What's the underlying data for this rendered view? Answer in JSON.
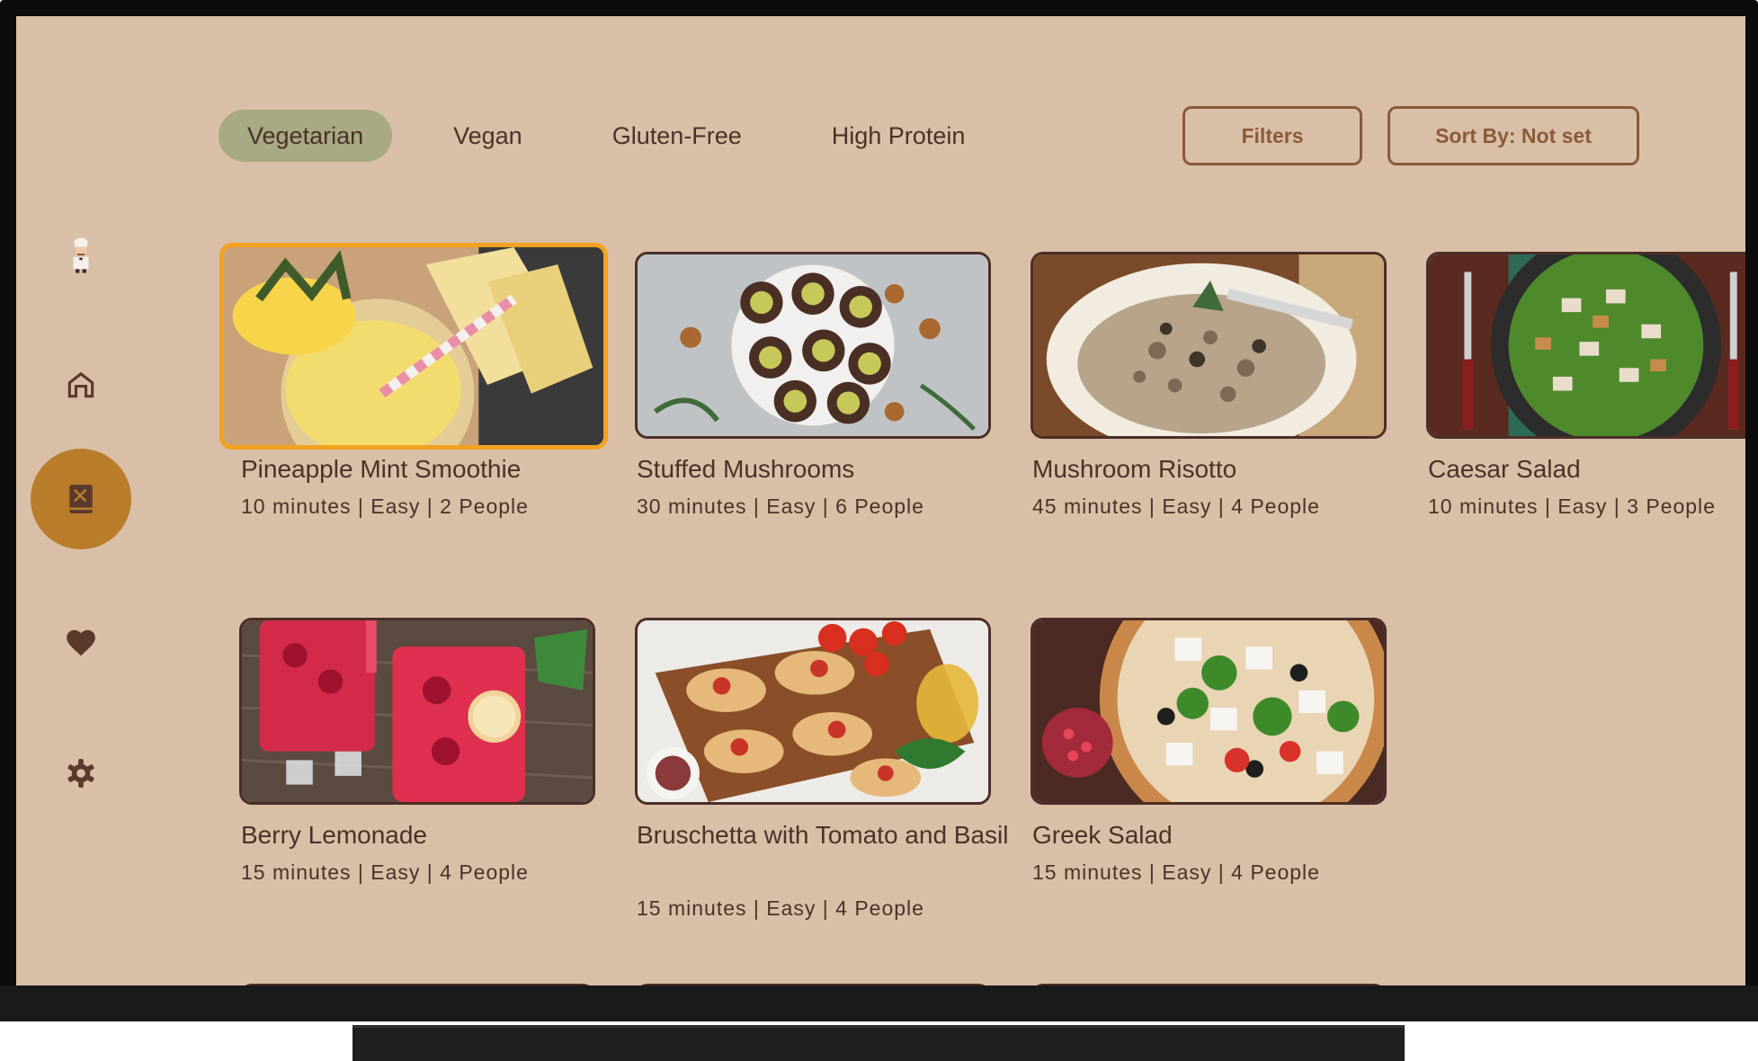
{
  "filters": {
    "chips": [
      {
        "label": "Vegetarian",
        "active": true
      },
      {
        "label": "Vegan",
        "active": false
      },
      {
        "label": "Gluten-Free",
        "active": false
      },
      {
        "label": "High Protein",
        "active": false
      }
    ],
    "filters_button": "Filters",
    "sort_button": "Sort By: Not set"
  },
  "nav": {
    "items": [
      {
        "name": "profile-avatar",
        "icon": "chef-avatar"
      },
      {
        "name": "home",
        "icon": "home-icon"
      },
      {
        "name": "recipes",
        "icon": "recipe-book-icon",
        "active": true
      },
      {
        "name": "favorites",
        "icon": "heart-icon"
      },
      {
        "name": "settings",
        "icon": "gear-icon"
      }
    ]
  },
  "recipes": [
    {
      "title": "Pineapple Mint Smoothie",
      "meta": "10 minutes | Easy | 2 People"
    },
    {
      "title": "Stuffed Mushrooms",
      "meta": "30 minutes | Easy | 6 People"
    },
    {
      "title": "Mushroom Risotto",
      "meta": "45 minutes | Easy | 4 People"
    },
    {
      "title": "Caesar Salad",
      "meta": "10 minutes | Easy | 3 People"
    },
    {
      "title": "Berry Lemonade",
      "meta": "15 minutes | Easy | 4 People"
    },
    {
      "title": "Bruschetta with Tomato and Basil",
      "meta": "15 minutes | Easy | 4 People"
    },
    {
      "title": "Greek Salad",
      "meta": "15 minutes | Easy | 4 People"
    }
  ],
  "colors": {
    "background": "#d9bfa7",
    "chip_active": "#a8a985",
    "nav_active": "#b97c2b",
    "focus_border": "#f3a21f",
    "text": "#4a3226",
    "button_outline": "#8a5a3a"
  }
}
